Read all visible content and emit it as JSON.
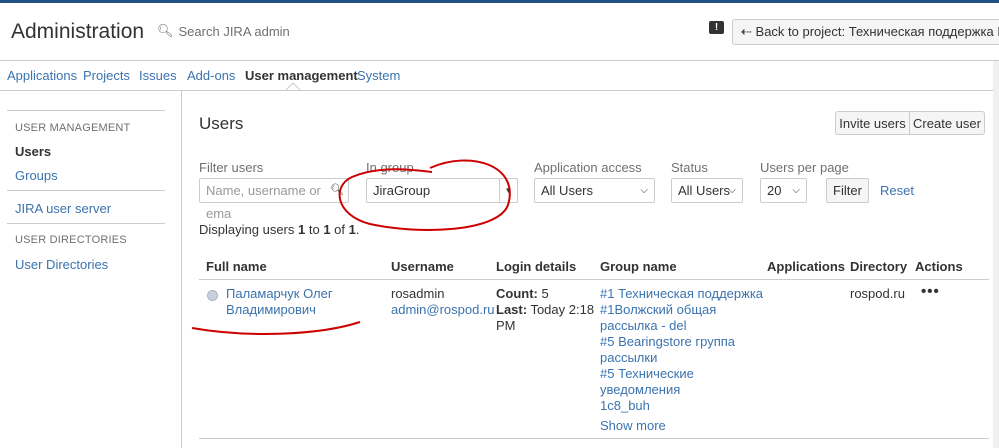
{
  "header": {
    "title": "Administration",
    "search_placeholder": "Search JIRA admin",
    "back_label": "Back to project: Техническая поддержка ИТ"
  },
  "nav": {
    "items": [
      "Applications",
      "Projects",
      "Issues",
      "Add-ons",
      "User management",
      "System"
    ],
    "active": "User management"
  },
  "sidebar": {
    "section1": "USER MANAGEMENT",
    "users": "Users",
    "groups": "Groups",
    "jira_user_server": "JIRA user server",
    "section2": "USER DIRECTORIES",
    "user_directories": "User Directories"
  },
  "main": {
    "title": "Users",
    "invite_label": "Invite users",
    "create_label": "Create user"
  },
  "filters": {
    "filter_users_label": "Filter users",
    "filter_users_placeholder": "Name, username or ema",
    "in_group_label": "In group",
    "in_group_value": "JiraGroup",
    "app_access_label": "Application access",
    "app_access_value": "All Users",
    "status_label": "Status",
    "status_value": "All Users",
    "per_page_label": "Users per page",
    "per_page_value": "20",
    "filter_label": "Filter",
    "reset_label": "Reset"
  },
  "displaying": {
    "prefix": "Displaying users ",
    "from": "1",
    "to_word": " to ",
    "to": "1",
    "of_word": " of ",
    "total": "1",
    "suffix": "."
  },
  "table": {
    "headers": [
      "Full name",
      "Username",
      "Login details",
      "Group name",
      "Applications",
      "Directory",
      "Actions"
    ],
    "row": {
      "fullname_line1": "Паламарчук Олег",
      "fullname_line2": "Владимирович",
      "username": "rosadmin",
      "email": "admin@rospod.ru",
      "count_label": "Count:",
      "count_value": " 5",
      "last_label": "Last:",
      "last_value": " Today 2:18",
      "last_value2": "PM",
      "groups": [
        "#1 Техническая поддержка",
        "#1Волжский общая",
        "рассылка - del",
        "#5 Bearingstore группа",
        "рассылки",
        "#5 Технические",
        "уведомления",
        "1c8_buh"
      ],
      "show_more": "Show more",
      "directory": "rospod.ru",
      "actions_glyph": "•••"
    }
  },
  "colors": {
    "link": "#3b73af",
    "annotation": "#cc0000",
    "top_stripe": "#205081"
  }
}
